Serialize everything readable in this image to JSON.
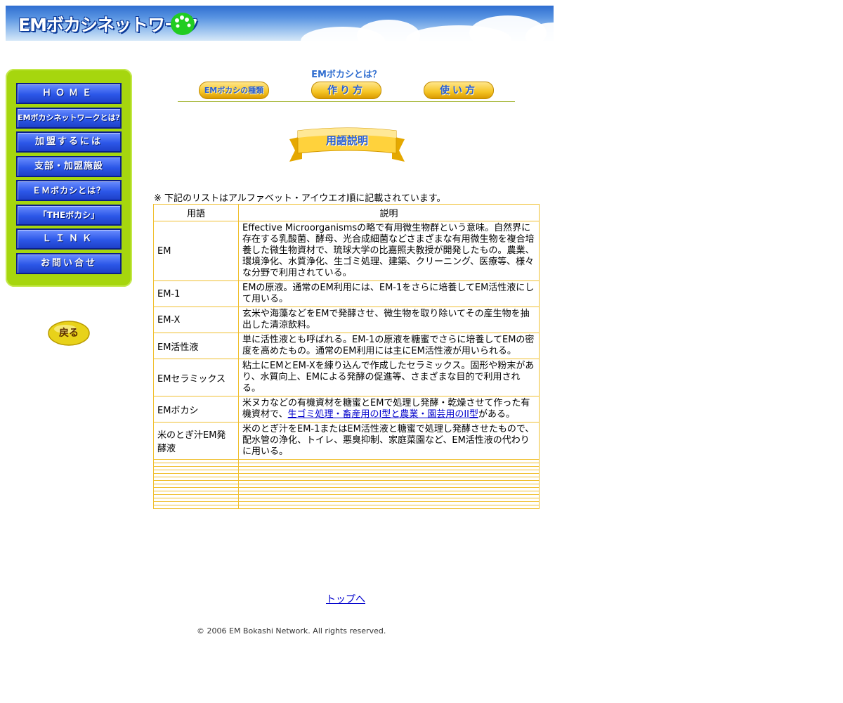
{
  "banner": {
    "title": "EMボカシネットワーク",
    "colors": {
      "sky": "#3a7ad6",
      "title_outline": "#0b3a9a",
      "logo": "#22cc22"
    }
  },
  "sidebar": {
    "background": "#a6d60e",
    "items": [
      {
        "label": "ＨＯＭＥ"
      },
      {
        "label": "EMボカシネットワークとは?"
      },
      {
        "label": "加盟するには"
      },
      {
        "label": "支部・加盟施設"
      },
      {
        "label": "ＥＭボカシとは？"
      },
      {
        "label": "「THEボカシ」"
      },
      {
        "label": "ＬＩＮＫ"
      },
      {
        "label": "お問い合せ"
      }
    ],
    "back_label": "戻る"
  },
  "subnav": {
    "title": "EMボカシとは？",
    "tabs": [
      {
        "label": "EMボカシの種類"
      },
      {
        "label": "作り方"
      },
      {
        "label": "使い方"
      }
    ]
  },
  "section_ribbon": "用語説明",
  "note": "※ 下記のリストはアルファベット・アイウエオ順に記載されています。",
  "table": {
    "headers": [
      "用語",
      "説明"
    ],
    "rows": [
      {
        "term": "EM",
        "desc": "Effective Microorganismsの略で有用微生物群という意味。自然界に存在する乳酸菌、酵母、光合成細菌などさまざまな有用微生物を複合培養した微生物資材で、琉球大学の比嘉照夫教授が開発したもの。農業、環境浄化、水質浄化、生ゴミ処理、建築、クリーニング、医療等、様々な分野で利用されている。"
      },
      {
        "term": "EM-1",
        "desc": "EMの原液。通常のEM利用には、EM-1をさらに培養してEM活性液にして用いる。"
      },
      {
        "term": "EM-X",
        "desc": "玄米や海藻などをEMで発酵させ、微生物を取り除いてその産生物を抽出した清涼飲料。"
      },
      {
        "term": "EM活性液",
        "desc": "単に活性液とも呼ばれる。EM-1の原液を糖蜜でさらに培養してEMの密度を高めたもの。通常のEM利用には主にEM活性液が用いられる。"
      },
      {
        "term": "EMセラミックス",
        "desc": "粘土にEMとEM-Xを練り込んで作成したセラミックス。固形や粉末があり、水質向上、EMによる発酵の促進等、さまざまな目的で利用される。"
      },
      {
        "term": "EMボカシ",
        "desc_pre": "米ヌカなどの有機資材を糖蜜とEMで処理し発酵・乾燥させて作った有機資材で、",
        "desc_link": "生ゴミ処理・畜産用のI型と農業・園芸用のII型",
        "desc_post": "がある。"
      },
      {
        "term": "米のとぎ汁EM発酵液",
        "desc": "米のとぎ汁をEM-1またはEM活性液と糖蜜で処理し発酵させたもので、配水管の浄化、トイレ、悪臭抑制、家庭菜園など、EM活性液の代わりに用いる。"
      }
    ],
    "border_color": "#f0c030"
  },
  "footer": {
    "to_top": "トップへ",
    "copyright": "© 2006 EM Bokashi Network. All rights reserved."
  }
}
